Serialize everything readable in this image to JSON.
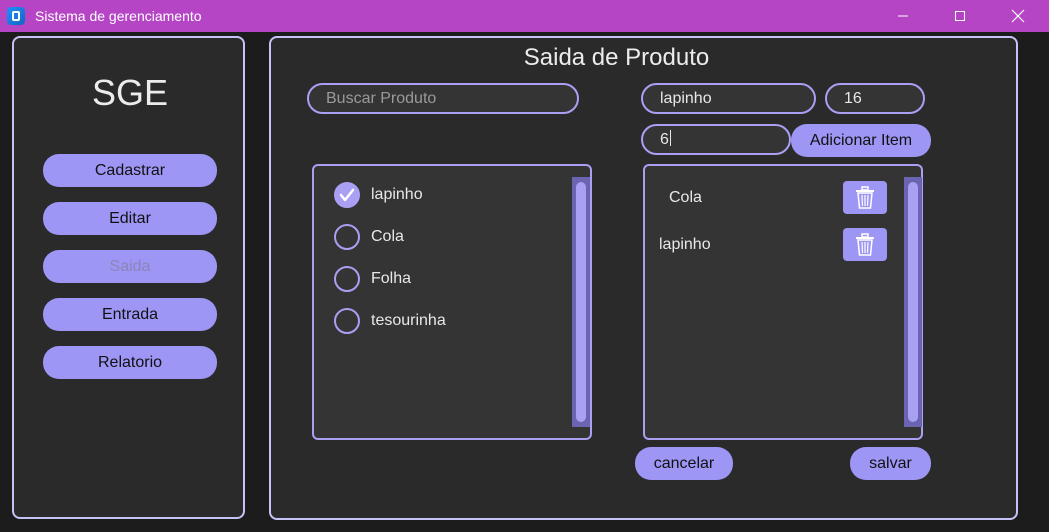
{
  "window": {
    "title": "Sistema de gerenciamento",
    "icons": {
      "app": "app-icon",
      "minimize": "minimize-icon",
      "maximize": "maximize-icon",
      "close": "close-icon"
    }
  },
  "sidebar": {
    "brand": "SGE",
    "items": [
      {
        "label": "Cadastrar",
        "enabled": true
      },
      {
        "label": "Editar",
        "enabled": true
      },
      {
        "label": "Saida",
        "enabled": false
      },
      {
        "label": "Entrada",
        "enabled": true
      },
      {
        "label": "Relatorio",
        "enabled": true
      }
    ]
  },
  "main": {
    "title": "Saida de Produto",
    "search": {
      "placeholder": "Buscar Produto",
      "value": ""
    },
    "product_field": "lapinho",
    "stock_field": "16",
    "quantity_field": "6",
    "add_item_label": "Adicionar Item",
    "products": [
      {
        "name": "lapinho",
        "selected": true
      },
      {
        "name": "Cola",
        "selected": false
      },
      {
        "name": "Folha",
        "selected": false
      },
      {
        "name": "tesourinha",
        "selected": false
      }
    ],
    "cart": [
      {
        "name": "Cola",
        "icon": "trash-icon"
      },
      {
        "name": "lapinho",
        "icon": "trash-icon"
      }
    ],
    "cancel_label": "cancelar",
    "save_label": "salvar"
  },
  "colors": {
    "titlebar": "#b545c5",
    "accent": "#9d96f5",
    "border": "#a99ff3",
    "panel": "#2a2a2a",
    "background": "#1c1c1c"
  }
}
